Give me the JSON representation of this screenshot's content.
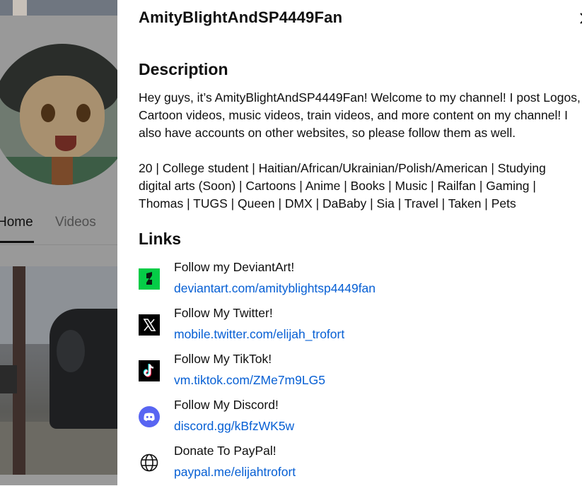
{
  "background": {
    "tabs": [
      {
        "label": "Home"
      },
      {
        "label": "Videos"
      }
    ]
  },
  "panel": {
    "title": "AmityBlightAndSP4449Fan",
    "close_icon": "close-icon",
    "description": {
      "heading": "Description",
      "paragraph1": "Hey guys, it’s AmityBlightAndSP4449Fan! Welcome to my channel! I post Logos, Cartoon videos, music videos, train videos, and more content on my channel! I also have accounts on other websites, so please follow them as well.",
      "paragraph2": "20 | College student | Haitian/African/Ukrainian/Polish/American | Studying digital arts (Soon) | Cartoons | Anime | Books | Music | Railfan | Gaming | Thomas | TUGS | Queen | DMX | DaBaby | Sia | Travel | Taken | Pets"
    },
    "links": {
      "heading": "Links",
      "items": [
        {
          "title": "Follow my DeviantArt!",
          "url": "deviantart.com/amityblightsp4449fan",
          "icon": "deviantart-icon"
        },
        {
          "title": "Follow My Twitter!",
          "url": "mobile.twitter.com/elijah_trofort",
          "icon": "x-twitter-icon"
        },
        {
          "title": "Follow My TikTok!",
          "url": "vm.tiktok.com/ZMe7m9LG5",
          "icon": "tiktok-icon"
        },
        {
          "title": "Follow My Discord!",
          "url": "discord.gg/kBfzWK5w",
          "icon": "discord-icon"
        },
        {
          "title": "Donate To PayPal!",
          "url": "paypal.me/elijahtrofort",
          "icon": "globe-icon"
        }
      ]
    }
  },
  "colors": {
    "link_blue": "#065fd4",
    "deviantart_green": "#05cc47",
    "discord_blurple": "#5865f2",
    "overlay_gray": "#9a9a9a"
  }
}
